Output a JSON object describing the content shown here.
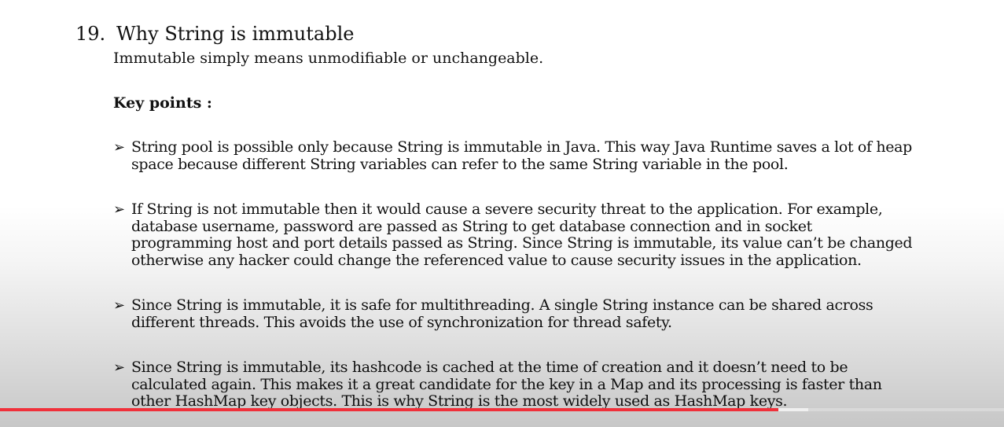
{
  "heading": {
    "number": "19.",
    "title": "Why String is immutable"
  },
  "intro": "Immutable simply means unmodifiable or unchangeable.",
  "key_points_label": "Key points :",
  "bullet_icon": "arrowhead-bullet",
  "bullets": [
    {
      "lines": [
        "String pool is possible only because String is immutable in Java. This way Java Runtime saves a lot of heap",
        "space because different String variables can refer to the same String variable in the pool."
      ]
    },
    {
      "lines": [
        "If String is not immutable then it would cause a severe security threat to the application. For example,",
        "database username, password are passed as String to get database connection and in socket",
        "programming host and port details passed as String. Since String is immutable, its value can’t be changed",
        "otherwise any hacker could change the referenced value to cause security issues in the application."
      ]
    },
    {
      "lines": [
        "Since String is immutable, it is safe for multithreading. A single String instance can be shared across",
        "different threads. This avoids the use of synchronization for thread safety."
      ]
    },
    {
      "lines": [
        "Since String is immutable, its hashcode is cached at the time of creation and it doesn’t need to be",
        "calculated again. This makes it a great candidate for the key in a Map and its processing is faster than",
        "other HashMap key objects. This is why String is the most widely used as HashMap keys."
      ]
    }
  ],
  "video_progress": {
    "played_fraction": 0.775,
    "buffered_fraction": 0.805,
    "played_color": "#f0303a"
  }
}
